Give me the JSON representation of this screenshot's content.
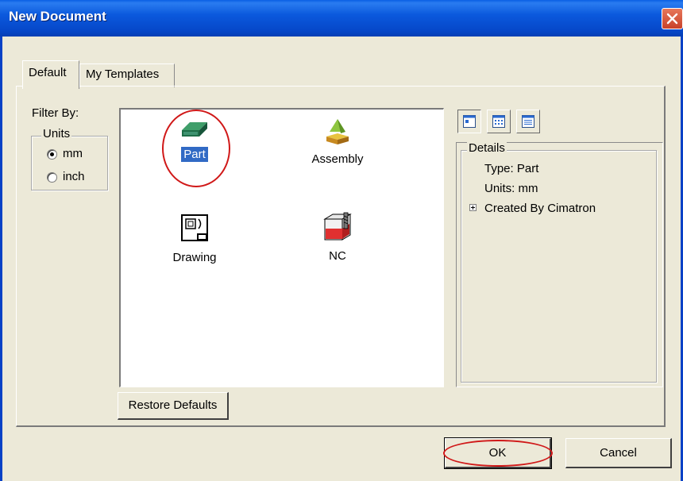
{
  "window": {
    "title": "New Document"
  },
  "tabs": [
    {
      "label": "Default",
      "active": true
    },
    {
      "label": "My Templates",
      "active": false
    }
  ],
  "filter": {
    "label": "Filter By:",
    "units_legend": "Units",
    "options": [
      {
        "label": "mm",
        "selected": true
      },
      {
        "label": "inch",
        "selected": false
      }
    ]
  },
  "documents": [
    {
      "label": "Part",
      "icon": "part-icon",
      "selected": true
    },
    {
      "label": "Assembly",
      "icon": "assembly-icon",
      "selected": false
    },
    {
      "label": "Drawing",
      "icon": "drawing-icon",
      "selected": false
    },
    {
      "label": "NC",
      "icon": "nc-icon",
      "selected": false
    }
  ],
  "view_buttons": [
    {
      "icon": "large-icons-view-icon",
      "active": true
    },
    {
      "icon": "small-icons-view-icon",
      "active": false
    },
    {
      "icon": "details-view-icon",
      "active": false
    }
  ],
  "details": {
    "legend": "Details",
    "type_line": "Type: Part",
    "units_line": "Units: mm",
    "created_line": "Created By Cimatron"
  },
  "buttons": {
    "restore_defaults": "Restore Defaults",
    "ok": "OK",
    "cancel": "Cancel"
  },
  "colors": {
    "titlebar": "#0b59dd",
    "selection": "#316ac5",
    "annotation": "#d01818",
    "dialog_bg": "#ece9d8"
  }
}
